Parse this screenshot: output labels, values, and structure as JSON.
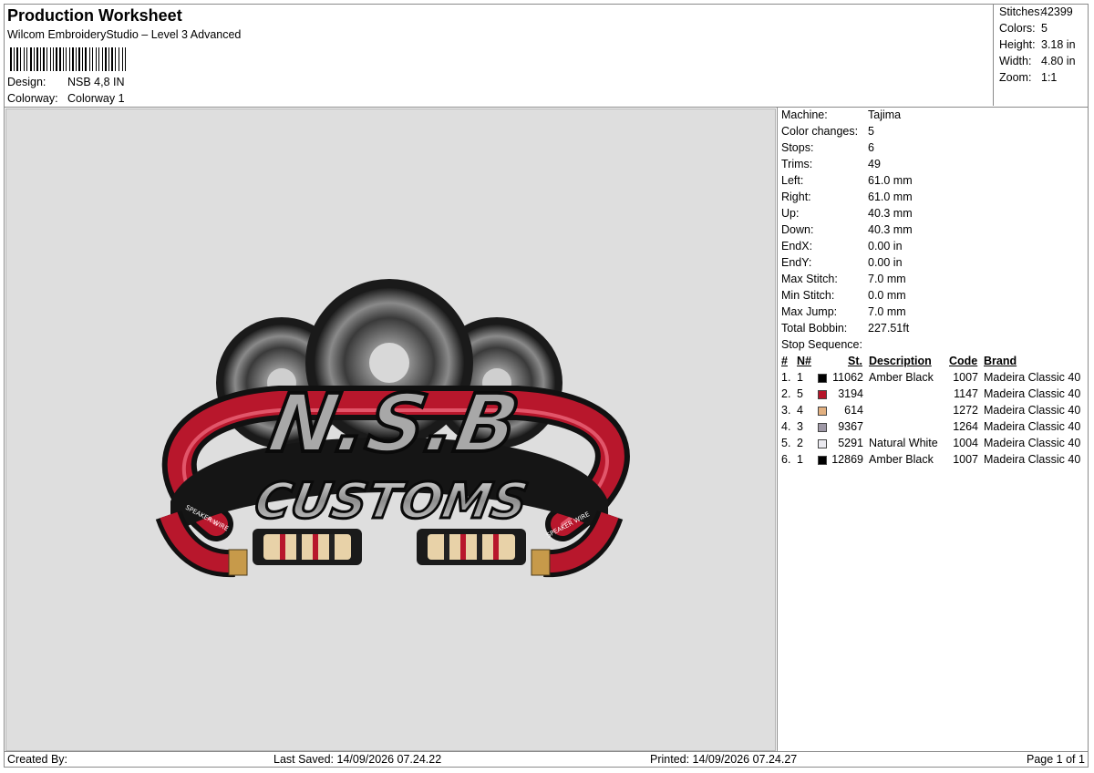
{
  "header": {
    "title": "Production Worksheet",
    "subtitle": "Wilcom EmbroideryStudio – Level 3 Advanced",
    "design_label": "Design:",
    "design_value": "NSB 4,8 IN",
    "colorway_label": "Colorway:",
    "colorway_value": "Colorway 1"
  },
  "stats": {
    "stitches_label": "Stitches:",
    "stitches": "42399",
    "colors_label": "Colors:",
    "colors": "5",
    "height_label": "Height:",
    "height": "3.18 in",
    "width_label": "Width:",
    "width": "4.80 in",
    "zoom_label": "Zoom:",
    "zoom": "1:1"
  },
  "design_artwork": {
    "top_text": "N.S.B",
    "bottom_text": "CUSTOMS",
    "left_cable_text": "SPEAKER WIRE",
    "right_cable_text": "SPEAKER WIRE"
  },
  "machine_info": [
    {
      "label": "Machine:",
      "value": "Tajima"
    },
    {
      "label": "Color changes:",
      "value": "5"
    },
    {
      "label": "Stops:",
      "value": "6"
    },
    {
      "label": "Trims:",
      "value": "49"
    },
    {
      "label": "Left:",
      "value": "61.0 mm"
    },
    {
      "label": "Right:",
      "value": "61.0 mm"
    },
    {
      "label": "Up:",
      "value": "40.3 mm"
    },
    {
      "label": "Down:",
      "value": "40.3 mm"
    },
    {
      "label": "EndX:",
      "value": "0.00 in"
    },
    {
      "label": "EndY:",
      "value": "0.00 in"
    },
    {
      "label": "Max Stitch:",
      "value": "7.0 mm"
    },
    {
      "label": "Min Stitch:",
      "value": "0.0 mm"
    },
    {
      "label": "Max Jump:",
      "value": "7.0 mm"
    },
    {
      "label": "Total Bobbin:",
      "value": "227.51ft"
    },
    {
      "label": "Stop Sequence:",
      "value": ""
    }
  ],
  "stop_sequence": {
    "headers": {
      "num": "#",
      "n": "N#",
      "st": "St.",
      "desc": "Description",
      "code": "Code",
      "brand": "Brand"
    },
    "rows": [
      {
        "num": "1.",
        "n": "1",
        "color": "#000000",
        "st": "11062",
        "desc": "Amber Black",
        "code": "1007",
        "brand": "Madeira Classic 40"
      },
      {
        "num": "2.",
        "n": "5",
        "color": "#b5152a",
        "st": "3194",
        "desc": "",
        "code": "1147",
        "brand": "Madeira Classic 40"
      },
      {
        "num": "3.",
        "n": "4",
        "color": "#e2b080",
        "st": "614",
        "desc": "",
        "code": "1272",
        "brand": "Madeira Classic 40"
      },
      {
        "num": "4.",
        "n": "3",
        "color": "#9e98a6",
        "st": "9367",
        "desc": "",
        "code": "1264",
        "brand": "Madeira Classic 40"
      },
      {
        "num": "5.",
        "n": "2",
        "color": "#ebeaf0",
        "st": "5291",
        "desc": "Natural White",
        "code": "1004",
        "brand": "Madeira Classic 40"
      },
      {
        "num": "6.",
        "n": "1",
        "color": "#000000",
        "st": "12869",
        "desc": "Amber Black",
        "code": "1007",
        "brand": "Madeira Classic 40"
      }
    ]
  },
  "footer": {
    "created_by": "Created By:",
    "last_saved": "Last Saved: 14/09/2026 07.24.22",
    "printed": "Printed: 14/09/2026 07.24.27",
    "page": "Page 1 of 1"
  }
}
